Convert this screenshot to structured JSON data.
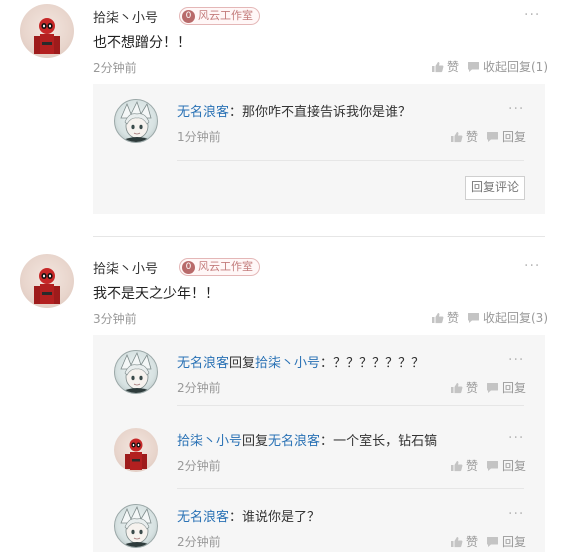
{
  "comments": [
    {
      "author": "拾柒丶小号",
      "badge_num": "0",
      "badge_label": "风云工作室",
      "content": "也不想蹭分！！",
      "time": "2分钟前",
      "like_label": "赞",
      "reply_toggle_label": "收起回复(1)",
      "replies": [
        {
          "author": "无名浪客",
          "sep": "：",
          "text": "那你咋不直接告诉我你是谁？",
          "time": "1分钟前",
          "like_label": "赞",
          "reply_label": "回复"
        }
      ],
      "reply_comment_button": "回复评论"
    },
    {
      "author": "拾柒丶小号",
      "badge_num": "0",
      "badge_label": "风云工作室",
      "content": "我不是天之少年！！",
      "time": "3分钟前",
      "like_label": "赞",
      "reply_toggle_label": "收起回复(3)",
      "replies": [
        {
          "author": "无名浪客",
          "reply_word": "回复",
          "target": "拾柒丶小号",
          "sep": "：",
          "text": "？？？？？？？",
          "time": "2分钟前",
          "like_label": "赞",
          "reply_label": "回复"
        },
        {
          "author": "拾柒丶小号",
          "reply_word": "回复",
          "target": "无名浪客",
          "sep": "：",
          "text": "一个室长，钻石镐",
          "time": "2分钟前",
          "like_label": "赞",
          "reply_label": "回复"
        },
        {
          "author": "无名浪客",
          "sep": "：",
          "text": "谁说你是了？",
          "time": "2分钟前",
          "like_label": "赞",
          "reply_label": "回复"
        }
      ]
    }
  ],
  "more_glyph": "···",
  "colors": {
    "link": "#2a72b5",
    "muted": "#999999",
    "panel": "#f6f6f6"
  },
  "icons": {
    "like": "thumbs-up-icon",
    "reply": "speech-bubble-icon",
    "more": "more-dots-icon"
  }
}
